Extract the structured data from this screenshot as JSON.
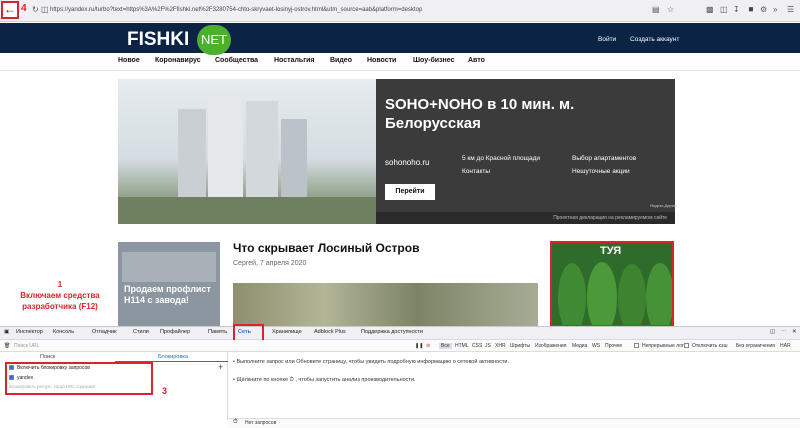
{
  "browser": {
    "url": "https://yandex.ru/turbo?text=https%3A%2F%2Ffishki.net%2F3280754-chto-skryvaet-losinyj-ostrov.html&utm_source=aab&platform=desktop",
    "marker4": "4"
  },
  "site": {
    "logo_text": "FISHKI",
    "logo_badge": "NET",
    "login": "Войти",
    "signup": "Создать аккаунт",
    "nav": [
      "Новое",
      "Коронавирус",
      "Сообщества",
      "Ностальгия",
      "Видео",
      "Новости",
      "Шоу-бизнес",
      "Авто"
    ]
  },
  "ad": {
    "title": "SOHO+NOHO в 10 мин. м. Белорусская",
    "domain": "sohonoho.ru",
    "links": [
      "5 км до Красной площади",
      "Выбор апартаментов",
      "Контакты",
      "Нешуточные акции"
    ],
    "button": "Перейти",
    "small": "Яндекс.Директ",
    "declaration": "Проектная декларация на рекламируемом сайте"
  },
  "article": {
    "title": "Что скрывает Лосиный Остров",
    "date": "Сергей, 7 апреля 2020",
    "left_card": "Продаем профлист Н114 с завода!",
    "right_card": "ТУЯ"
  },
  "annotations": {
    "a1_num": "1",
    "a1_text": "Включаем средства разработчика (F12)",
    "a2": "2",
    "a3": "3"
  },
  "devtools": {
    "tabs": [
      "Инспектор",
      "Консоль",
      "Отладчик",
      "Стили",
      "Профайлер",
      "Память",
      "Сеть",
      "Хранилище",
      "Adblock Plus",
      "Поддержка доступности"
    ],
    "filter_placeholder": "Поиск URL",
    "filters": [
      "Все",
      "HTML",
      "CSS",
      "JS",
      "XHR",
      "Шрифты",
      "Изображения",
      "Медиа",
      "WS",
      "Прочее"
    ],
    "persist_logs": "Непрерывные логи",
    "disable_cache": "Отключить кэш",
    "throttling": "Без ограничения",
    "har": "HAR",
    "left_tabs": {
      "search": "Поиск",
      "blocking": "Блокировка"
    },
    "block_enable": "Включить блокировку запросов",
    "block_item": "yandex",
    "block_placeholder": "Блокировать ресурс, когда URL содержит",
    "msg1": "• Выполните запрос или  Обновите  страницу, чтобы увидеть подробную информацию о сетевой активности.",
    "msg2": "• Щёлкните по кнопке   ⏱   , чтобы запустить анализ производительности.",
    "status": "Нет запросов"
  }
}
